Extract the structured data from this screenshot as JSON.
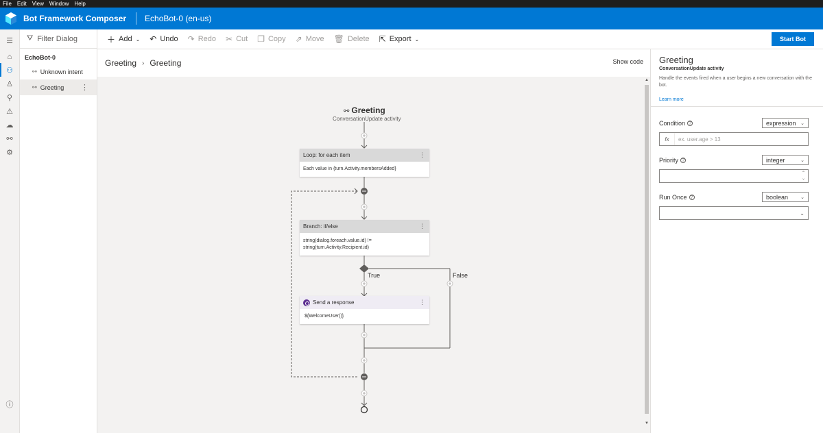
{
  "menu": [
    "File",
    "Edit",
    "View",
    "Window",
    "Help"
  ],
  "app": {
    "title": "Bot Framework Composer",
    "bot_name": "EchoBot-0 (en-us)"
  },
  "tree": {
    "filter_placeholder": "Filter Dialog",
    "root": "EchoBot-0",
    "items": [
      {
        "label": "Unknown intent",
        "selected": false
      },
      {
        "label": "Greeting",
        "selected": true
      }
    ]
  },
  "toolbar": {
    "add": "Add",
    "undo": "Undo",
    "redo": "Redo",
    "cut": "Cut",
    "copy": "Copy",
    "move": "Move",
    "delete": "Delete",
    "export": "Export",
    "start_bot": "Start Bot"
  },
  "breadcrumb": [
    "Greeting",
    "Greeting"
  ],
  "show_code": "Show code",
  "flow": {
    "trigger_title": "Greeting",
    "trigger_sub": "ConversationUpdate activity",
    "loop": {
      "title": "Loop: for each item",
      "body": "Each value in {turn.Activity.membersAdded}"
    },
    "branch": {
      "title": "Branch: if/else",
      "body_line1": "string(dialog.foreach.value.id) !=",
      "body_line2": "string(turn.Activity.Recipient.id)"
    },
    "true_label": "True",
    "false_label": "False",
    "response": {
      "title": "Send a response",
      "body": "${WelcomeUser()}"
    }
  },
  "props": {
    "title": "Greeting",
    "subtitle": "ConversationUpdate activity",
    "description": "Handle the events fired when a user begins a new conversation with the bot.",
    "learn_more": "Learn more",
    "condition": {
      "label": "Condition",
      "type": "expression",
      "placeholder": "ex. user.age > 13",
      "fx": "fx"
    },
    "priority": {
      "label": "Priority",
      "type": "integer"
    },
    "run_once": {
      "label": "Run Once",
      "type": "boolean"
    }
  },
  "colors": {
    "accent": "#0078d4",
    "canvas": "#f3f2f1",
    "response_icon": "#5c2e91"
  }
}
